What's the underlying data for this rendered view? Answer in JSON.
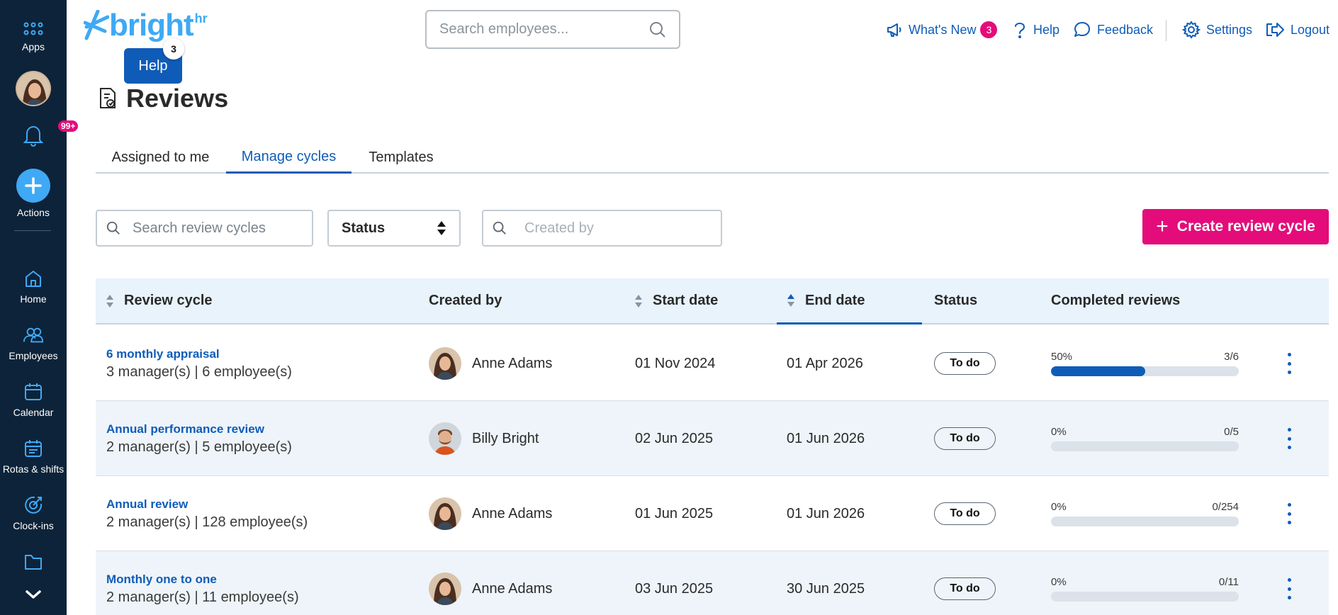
{
  "sidebar": {
    "apps_label": "Apps",
    "notifications_badge": "99+",
    "actions_label": "Actions",
    "items": [
      {
        "label": "Home"
      },
      {
        "label": "Employees"
      },
      {
        "label": "Calendar"
      },
      {
        "label": "Rotas & shifts"
      },
      {
        "label": "Clock-ins"
      }
    ]
  },
  "header": {
    "logo_text": "bright",
    "logo_suffix": "hr",
    "help_button": "Help",
    "help_count": "3",
    "search_placeholder": "Search employees...",
    "nav": {
      "whats_new": "What's New",
      "whats_new_count": "3",
      "help": "Help",
      "feedback": "Feedback",
      "settings": "Settings",
      "logout": "Logout"
    }
  },
  "page": {
    "title": "Reviews",
    "tabs": [
      {
        "label": "Assigned to me"
      },
      {
        "label": "Manage cycles"
      },
      {
        "label": "Templates"
      }
    ],
    "active_tab": "Manage cycles"
  },
  "filters": {
    "search_placeholder": "Search review cycles",
    "status_label": "Status",
    "created_by_placeholder": "Created by",
    "create_button": "Create review cycle"
  },
  "table": {
    "headers": {
      "review_cycle": "Review cycle",
      "created_by": "Created by",
      "start_date": "Start date",
      "end_date": "End date",
      "status": "Status",
      "completed": "Completed reviews"
    },
    "rows": [
      {
        "name": "6 monthly appraisal",
        "sub": "3 manager(s) | 6 employee(s)",
        "creator": "Anne Adams",
        "start": "01 Nov 2024",
        "end": "01 Apr 2026",
        "status": "To do",
        "pct": "50%",
        "count": "3/6",
        "progress": 0.5
      },
      {
        "name": "Annual performance review",
        "sub": "2 manager(s) | 5 employee(s)",
        "creator": "Billy Bright",
        "start": "02 Jun 2025",
        "end": "01 Jun 2026",
        "status": "To do",
        "pct": "0%",
        "count": "0/5",
        "progress": 0
      },
      {
        "name": "Annual review",
        "sub": "2 manager(s) | 128 employee(s)",
        "creator": "Anne Adams",
        "start": "01 Jun 2025",
        "end": "01 Jun 2026",
        "status": "To do",
        "pct": "0%",
        "count": "0/254",
        "progress": 0
      },
      {
        "name": "Monthly one to one",
        "sub": "2 manager(s) | 11 employee(s)",
        "creator": "Anne Adams",
        "start": "03 Jun 2025",
        "end": "30 Jun 2025",
        "status": "To do",
        "pct": "0%",
        "count": "0/11",
        "progress": 0
      }
    ]
  },
  "colors": {
    "sidebar_bg": "#0d2339",
    "brand_blue": "#0f5cb8",
    "logo_blue": "#3fa9f5",
    "accent_pink": "#e40c7a"
  }
}
